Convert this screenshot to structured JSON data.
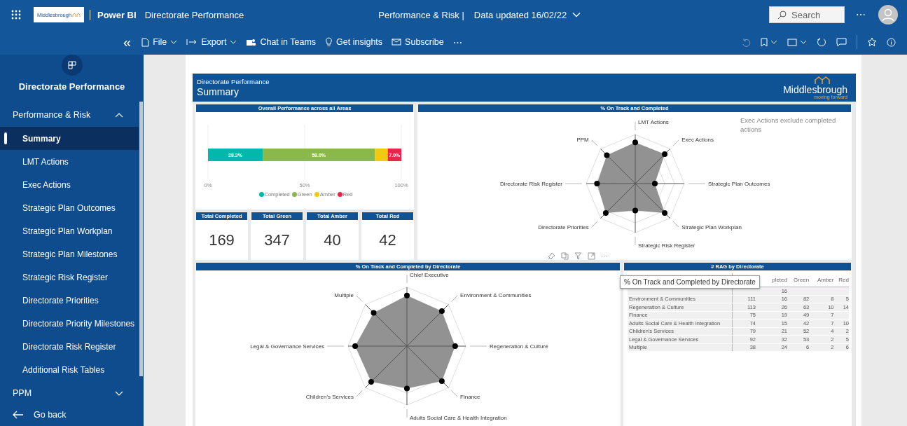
{
  "header": {
    "logo_text": "Middlesbrough",
    "app_name": "Power BI",
    "report_title": "Directorate Performance",
    "section": "Performance & Risk |",
    "updated": "Data updated 16/02/22",
    "search": {
      "placeholder": "Search"
    },
    "more": "⋯"
  },
  "toolbar": {
    "collapse": "«",
    "items": [
      {
        "kind": "file",
        "label": "File",
        "dropdown": true
      },
      {
        "kind": "export",
        "label": "Export",
        "dropdown": true
      },
      {
        "kind": "teams",
        "label": "Chat in Teams",
        "dropdown": false
      },
      {
        "kind": "insights",
        "label": "Get insights",
        "dropdown": false
      },
      {
        "kind": "subscribe",
        "label": "Subscribe",
        "dropdown": false
      }
    ],
    "more": "⋯"
  },
  "sidebar": {
    "title": "Directorate Performance",
    "sections": [
      {
        "label": "Performance & Risk",
        "expanded": true,
        "items": [
          {
            "label": "Summary",
            "selected": true
          },
          {
            "label": "LMT Actions",
            "selected": false
          },
          {
            "label": "Exec Actions",
            "selected": false
          },
          {
            "label": "Strategic Plan Outcomes",
            "selected": false
          },
          {
            "label": "Strategic Plan Workplan",
            "selected": false
          },
          {
            "label": "Strategic Plan Milestones",
            "selected": false
          },
          {
            "label": "Strategic Risk Register",
            "selected": false
          },
          {
            "label": "Directorate Priorities",
            "selected": false
          },
          {
            "label": "Directorate Priority Milestones",
            "selected": false
          },
          {
            "label": "Directorate Risk Register",
            "selected": false
          },
          {
            "label": "Additional Risk Tables",
            "selected": false
          }
        ]
      },
      {
        "label": "PPM",
        "expanded": false
      }
    ],
    "back": "Go back"
  },
  "report": {
    "subtitle": "Directorate Performance",
    "title": "Summary",
    "logo": {
      "name": "Middlesbrough",
      "tagline": "moving forward"
    },
    "overall": {
      "title": "Overall Performance across all Areas",
      "chart_data": {
        "type": "bar",
        "orientation": "horizontal",
        "stacked": true,
        "xlim": [
          0,
          1
        ],
        "xticks": [
          {
            "value": 0,
            "label": "0%"
          },
          {
            "value": 0.5,
            "label": "50%"
          },
          {
            "value": 1,
            "label": "100%"
          }
        ],
        "value_labels": [
          "28.3%",
          "58.0%",
          null,
          "7.0%"
        ],
        "legend": true,
        "series": [
          {
            "name": "Completed",
            "color": "#01b8aa",
            "values": [
              0.283
            ]
          },
          {
            "name": "Green",
            "color": "#8ab84a",
            "values": [
              0.58
            ]
          },
          {
            "name": "Amber",
            "color": "#f2c811",
            "values": [
              0.067
            ]
          },
          {
            "name": "Red",
            "color": "#e8254a",
            "values": [
              0.07
            ]
          }
        ]
      }
    },
    "cards": [
      {
        "title": "Total Completed",
        "value": "169"
      },
      {
        "title": "Total Green",
        "value": "347"
      },
      {
        "title": "Total Amber",
        "value": "40"
      },
      {
        "title": "Total Red",
        "value": "42"
      }
    ],
    "radar_top": {
      "title": "% On Track and Completed",
      "note": "Exec Actions exclude completed actions",
      "axes": [
        "LMT Actions",
        "Exec Actions",
        "Strategic Plan Outcomes",
        "Strategic Plan Workplan",
        "Strategic Risk Register",
        "Directorate Priorities",
        "Directorate Risk Register",
        "PPM"
      ],
      "more": "⋯"
    },
    "radar_bottom": {
      "title": "% On Track and Completed by Directorate",
      "axes": [
        "Chief Executive",
        "Environment & Communities",
        "Regeneration & Culture",
        "Finance",
        "Adults Social Care & Health Integration",
        "Children's Services",
        "Legal & Governance Services",
        "Multiple"
      ]
    },
    "rag_table": {
      "title": "# RAG by Directorate",
      "columns": [
        "pleted",
        "Green",
        "Amber",
        "Red"
      ],
      "rows": [
        {
          "completed": "16"
        },
        {
          "name": "Environment & Communities",
          "total": "111",
          "completed": "16",
          "green": "82",
          "amber": "8",
          "red": "5"
        },
        {
          "name": "Regeneration & Culture",
          "total": "113",
          "completed": "26",
          "green": "63",
          "amber": "10",
          "red": "14"
        },
        {
          "name": "Finance",
          "total": "75",
          "completed": "19",
          "green": "49",
          "amber": "7"
        },
        {
          "name": "Adults Social Care & Health Integration",
          "total": "74",
          "completed": "15",
          "green": "42",
          "amber": "7",
          "red": "10"
        },
        {
          "name": "Children's Services",
          "total": "79",
          "completed": "21",
          "green": "52",
          "amber": "4",
          "red": "2"
        },
        {
          "name": "Legal & Governance Services",
          "total": "92",
          "completed": "32",
          "green": "53",
          "amber": "2",
          "red": "5"
        },
        {
          "name": "Multiple",
          "total": "38",
          "completed": "24",
          "green": "6",
          "amber": "2",
          "red": "6"
        }
      ]
    },
    "tooltip": "% On Track and Completed by Directorate"
  }
}
